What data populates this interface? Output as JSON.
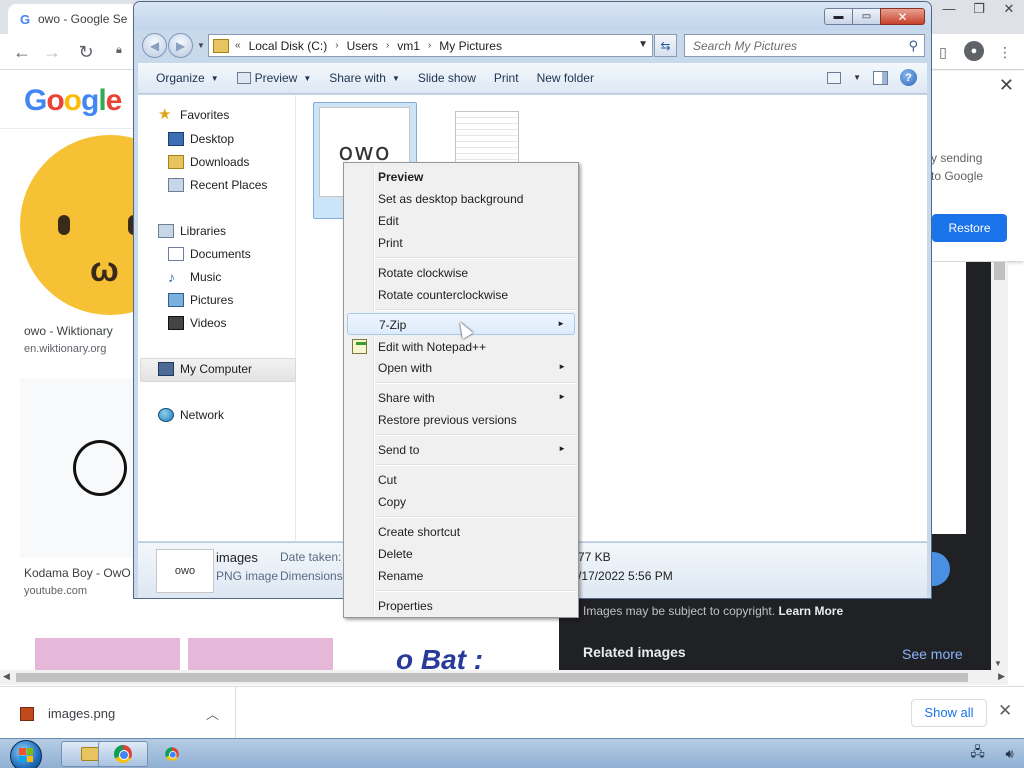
{
  "browser": {
    "tab_title": "owo - Google Se",
    "tab_favicon": "G",
    "nav_back": "←",
    "nav_forward": "→",
    "nav_reload": "↻",
    "window_controls": [
      "—",
      "❐",
      "✕"
    ],
    "toolbar_icons": [
      "sidebar-icon",
      "profile-icon",
      "kebab-menu-icon"
    ]
  },
  "google": {
    "logo": [
      "G",
      "o",
      "o",
      "g",
      "l",
      "e"
    ],
    "results": [
      {
        "caption": "owo - Wiktionary",
        "source": "en.wiktionary.org"
      },
      {
        "caption": "Kodama Boy - OwO",
        "source": "youtube.com"
      }
    ],
    "bat_text": "o Bat :",
    "restore_card": {
      "line1": "y sending",
      "line2": "to Google",
      "button": "Restore"
    },
    "copyright": "Images may be subject to copyright.",
    "learn_more": "Learn More",
    "related": "Related images",
    "see_more": "See more"
  },
  "downloads": {
    "file": "images.png",
    "show_all": "Show all"
  },
  "explorer": {
    "breadcrumb_prefix": "«",
    "breadcrumbs": [
      "Local Disk (C:)",
      "Users",
      "vm1",
      "My Pictures"
    ],
    "search_placeholder": "Search My Pictures",
    "commands": [
      "Organize",
      "Preview",
      "Share with",
      "Slide show",
      "Print",
      "New folder"
    ],
    "nav": {
      "favorites": "Favorites",
      "desktop": "Desktop",
      "downloads": "Downloads",
      "recent": "Recent Places",
      "libraries": "Libraries",
      "documents": "Documents",
      "music": "Music",
      "pictures": "Pictures",
      "videos": "Videos",
      "computer": "My Computer",
      "network": "Network"
    },
    "thumb_text": "owo",
    "details": {
      "name": "images",
      "type": "PNG image",
      "label1": "Date taken:",
      "label2": "Dimensions:",
      "value1": "77 KB",
      "value2": "/17/2022 5:56 PM"
    }
  },
  "context_menu": {
    "items": [
      {
        "label": "Preview",
        "bold": true
      },
      {
        "label": "Set as desktop background"
      },
      {
        "label": "Edit"
      },
      {
        "label": "Print"
      },
      {
        "label": "Rotate clockwise"
      },
      {
        "label": "Rotate counterclockwise"
      },
      {
        "label": "7-Zip",
        "submenu": true,
        "hot": true
      },
      {
        "label": "Edit with Notepad++",
        "icon": "notepad-plus-plus-icon"
      },
      {
        "label": "Open with",
        "submenu": true
      },
      {
        "label": "Share with",
        "submenu": true
      },
      {
        "label": "Restore previous versions"
      },
      {
        "label": "Send to",
        "submenu": true
      },
      {
        "label": "Cut"
      },
      {
        "label": "Copy"
      },
      {
        "label": "Create shortcut"
      },
      {
        "label": "Delete"
      },
      {
        "label": "Rename"
      },
      {
        "label": "Properties"
      }
    ],
    "submenu_arrow": "►"
  },
  "colors": {
    "google_blue": "#4285f4",
    "google_red": "#ea4335",
    "google_yellow": "#fbbc05",
    "google_green": "#34a853",
    "chrome_button_blue": "#1a73e8",
    "win7_aero": "#c9d9ec",
    "menu_hot": "#dcebfc"
  }
}
